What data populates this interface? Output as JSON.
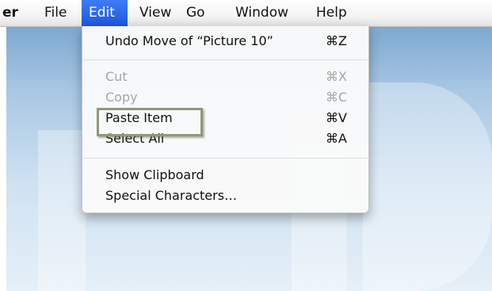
{
  "menubar": {
    "app_name": "er",
    "menus": [
      "File",
      "Edit",
      "View",
      "Go",
      "Window",
      "Help"
    ],
    "active_menu": "Edit"
  },
  "edit_menu": {
    "undo": {
      "label": "Undo Move of “Picture 10”",
      "shortcut": "⌘Z",
      "enabled": true
    },
    "cut": {
      "label": "Cut",
      "shortcut": "⌘X",
      "enabled": false
    },
    "copy": {
      "label": "Copy",
      "shortcut": "⌘C",
      "enabled": false
    },
    "paste": {
      "label": "Paste Item",
      "shortcut": "⌘V",
      "enabled": true,
      "annotated": true
    },
    "select_all": {
      "label": "Select All",
      "shortcut": "⌘A",
      "enabled": true
    },
    "show_clipboard": {
      "label": "Show Clipboard",
      "enabled": true
    },
    "special_characters": {
      "label": "Special Characters…",
      "enabled": true
    }
  },
  "colors": {
    "menu_highlight": "#1e57e1",
    "annotation_border": "#8e9a77",
    "disabled_text": "#a6a6a6"
  }
}
